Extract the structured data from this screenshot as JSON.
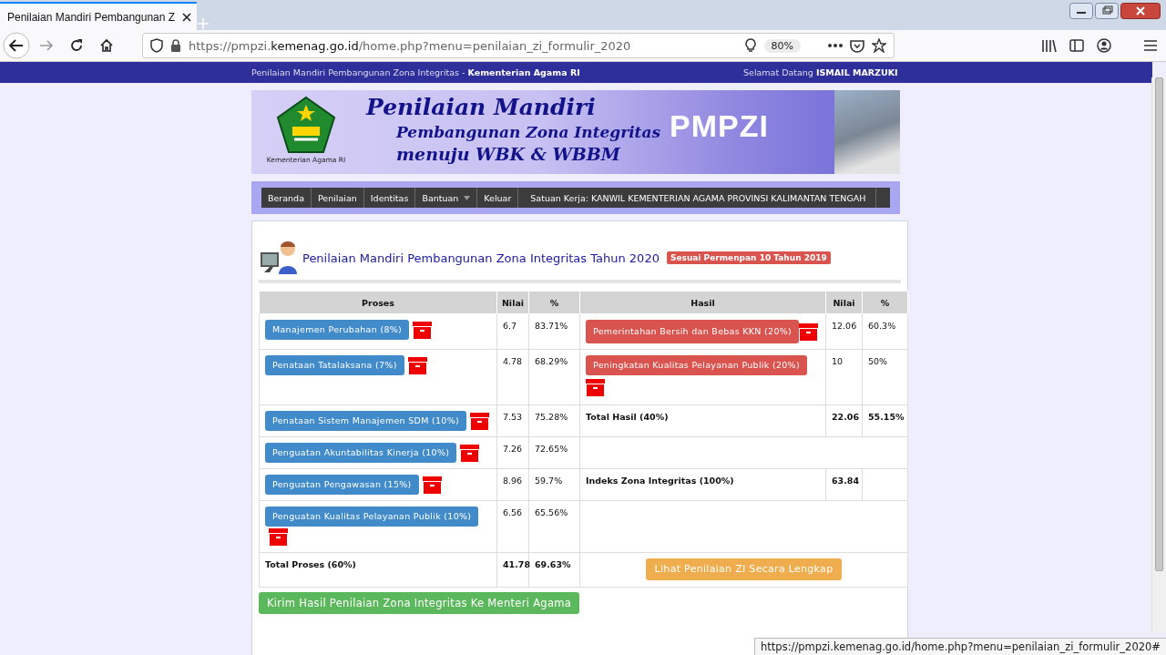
{
  "browser": {
    "tab_title": "Penilaian Mandiri Pembangunan Z",
    "url_prefix": "https://pmpzi.",
    "url_domain": "kemenag.go.id",
    "url_path": "/home.php?menu=penilaian_zi_formulir_2020",
    "zoom": "80%",
    "status_url": "https://pmpzi.kemenag.go.id/home.php?menu=penilaian_zi_formulir_2020#"
  },
  "header_bar": {
    "title": "Penilaian Mandiri Pembangunan Zona Integritas - **Kementerian Agama RI**",
    "greeting": "Selamat Datang **ISMAIL MARZUKI**"
  },
  "banner": {
    "logo_caption": "Kementerian Agama RI",
    "title": "Penilaian Mandiri",
    "subtitle": "Pembangunan Zona Integritas",
    "tagline": "menuju WBK & WBBM",
    "brand": "PMPZI"
  },
  "nav": {
    "items": [
      {
        "label": "Beranda",
        "kind": "link"
      },
      {
        "label": "Penilaian",
        "kind": "link"
      },
      {
        "label": "Identitas",
        "kind": "link"
      },
      {
        "label": "Bantuan",
        "kind": "dropdown"
      },
      {
        "label": "Keluar",
        "kind": "link"
      }
    ],
    "unit": "Satuan Kerja: KANWIL KEMENTERIAN AGAMA PROVINSI KALIMANTAN TENGAH"
  },
  "panel": {
    "title": "Penilaian Mandiri Pembangunan Zona Integritas Tahun 2020",
    "badge": "Sesuai Permenpan 10 Tahun 2019",
    "columns": [
      "Proses",
      "Nilai",
      "%",
      "Hasil",
      "Nilai",
      "%"
    ],
    "rows": [
      {
        "proses": "Manajemen Perubahan (8%)",
        "nilai": "6.7",
        "persen": "83.71%",
        "hasil": {
          "kind": "button",
          "label": "Pemerintahan Bersih dan Bebas KKN (20%)",
          "nilai": "12.06",
          "persen": "60.3%"
        }
      },
      {
        "proses": "Penataan Tatalaksana (7%)",
        "nilai": "4.78",
        "persen": "68.29%",
        "hasil": {
          "kind": "button",
          "label": "Peningkatan Kualitas Pelayanan Publik (20%)",
          "nilai": "10",
          "persen": "50%"
        }
      },
      {
        "proses": "Penataan Sistem Manajemen SDM (10%)",
        "nilai": "7.53",
        "persen": "75.28%",
        "hasil": {
          "kind": "total",
          "label": "Total Hasil (40%)",
          "nilai": "22.06",
          "persen": "55.15%"
        }
      },
      {
        "proses": "Penguatan Akuntabilitas Kinerja (10%)",
        "nilai": "7.26",
        "persen": "72.65%",
        "hasil": {
          "kind": "empty"
        }
      },
      {
        "proses": "Penguatan Pengawasan (15%)",
        "nilai": "8.96",
        "persen": "59.7%",
        "hasil": {
          "kind": "total",
          "label": "Indeks Zona Integritas (100%)",
          "nilai": "63.84"
        }
      },
      {
        "proses": "Penguatan Kualitas Pelayanan Publik (10%)",
        "nilai": "6.56",
        "persen": "65.56%",
        "hasil": {
          "kind": "empty"
        }
      }
    ],
    "total": {
      "label": "Total Proses (60%)",
      "nilai": "41.78",
      "persen": "69.63%",
      "action": "Lihat Penilaian ZI Secara Lengkap"
    },
    "submit": "Kirim Hasil Penilaian Zona Integritas Ke Menteri Agama"
  }
}
